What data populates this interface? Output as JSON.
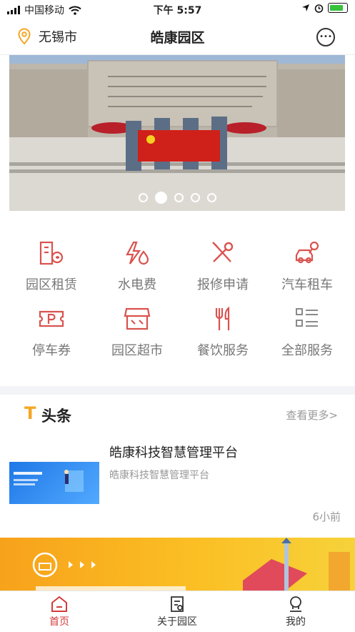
{
  "status_bar": {
    "carrier": "中国移动",
    "time": "下午 5:57"
  },
  "header": {
    "location": "无锡市",
    "title": "皓康园区"
  },
  "banner": {
    "slide_count": 5,
    "active_slide": 2
  },
  "services": [
    {
      "label": "园区租赁",
      "icon": "building-key-icon"
    },
    {
      "label": "水电费",
      "icon": "bolt-drop-icon"
    },
    {
      "label": "报修申请",
      "icon": "wrench-screwdriver-icon"
    },
    {
      "label": "汽车租车",
      "icon": "car-key-icon"
    },
    {
      "label": "停车券",
      "icon": "parking-ticket-icon"
    },
    {
      "label": "园区超市",
      "icon": "storefront-icon"
    },
    {
      "label": "餐饮服务",
      "icon": "fork-knife-icon"
    },
    {
      "label": "全部服务",
      "icon": "grid-list-icon"
    }
  ],
  "news": {
    "logo": "T",
    "section_title": "头条",
    "more_label": "查看更多>",
    "item": {
      "title": "皓康科技智慧管理平台",
      "subtitle": "皓康科技智慧管理平台",
      "time": "6小前"
    }
  },
  "tabbar": {
    "items": [
      {
        "label": "首页",
        "icon": "home-icon",
        "active": true
      },
      {
        "label": "关于园区",
        "icon": "document-icon",
        "active": false
      },
      {
        "label": "我的",
        "icon": "user-icon",
        "active": false
      }
    ]
  },
  "colors": {
    "accent": "#d33b3b",
    "icon_red": "#d9534f",
    "location_orange": "#f5a623"
  }
}
